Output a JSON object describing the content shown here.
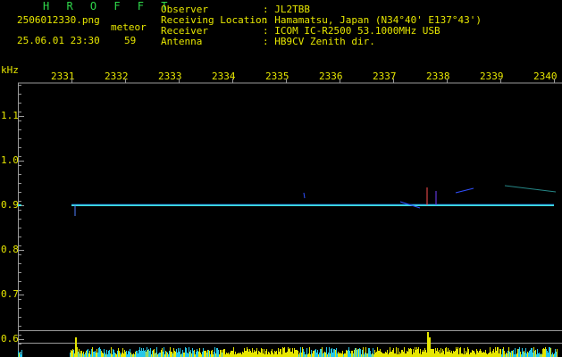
{
  "header": {
    "title": "H R O F F T",
    "filename": "2506012330.png",
    "datetime": "25.06.01 23:30",
    "meteor_label": "meteor",
    "meteor_count": "59"
  },
  "station_info": [
    {
      "label": "Observer",
      "value": ": JL2TBB"
    },
    {
      "label": "Receiving Location",
      "value": ": Hamamatsu, Japan (N34°40' E137°43')"
    },
    {
      "label": "Receiver",
      "value": ": ICOM IC-R2500 53.1000MHz USB"
    },
    {
      "label": "Antenna",
      "value": ": HB9CV Zenith dir."
    }
  ],
  "plot": {
    "y_unit_label": "kHz",
    "x_ticks": [
      "2331",
      "2332",
      "2333",
      "2334",
      "2335",
      "2336",
      "2337",
      "2338",
      "2339",
      "2340"
    ],
    "y_ticks": [
      "1.1",
      "1.0",
      "0.9",
      "0.8",
      "0.7",
      "0.6"
    ],
    "colors": {
      "background": "#000000",
      "text": "#e6e600",
      "title": "#2fd84a",
      "carrier": "#3fe0e0",
      "axis": "#9a9a9a",
      "counts": "#e6e600",
      "counts_alt": "#27c7e8"
    }
  }
}
